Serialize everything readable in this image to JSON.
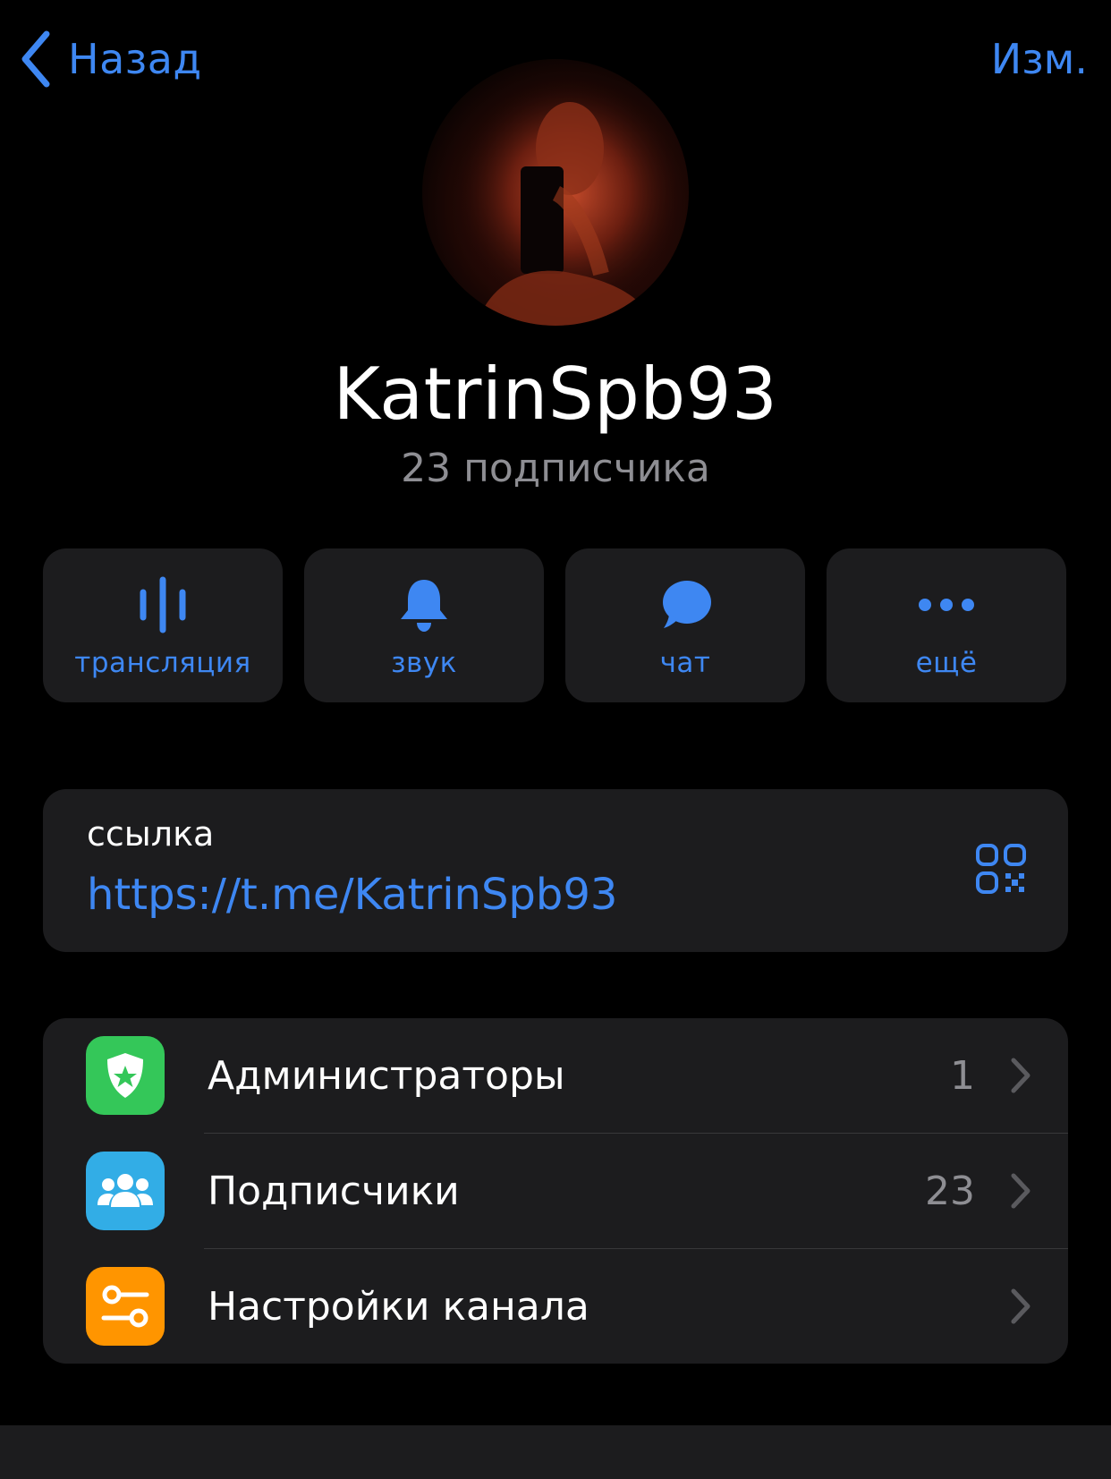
{
  "nav": {
    "back_label": "Назад",
    "edit_label": "Изм."
  },
  "channel": {
    "name": "KatrinSpb93",
    "subscribers_text": "23 подписчика"
  },
  "actions": [
    {
      "label": "трансляция",
      "icon": "broadcast-icon"
    },
    {
      "label": "звук",
      "icon": "bell-icon"
    },
    {
      "label": "чат",
      "icon": "chat-bubble-icon"
    },
    {
      "label": "ещё",
      "icon": "more-dots-icon"
    }
  ],
  "link": {
    "label": "ссылка",
    "url": "https://t.me/KatrinSpb93",
    "qr_icon": "qr-code-icon"
  },
  "list": [
    {
      "label": "Администраторы",
      "value": "1",
      "icon": "admin-badge-icon",
      "icon_color": "#34c759"
    },
    {
      "label": "Подписчики",
      "value": "23",
      "icon": "people-icon",
      "icon_color": "#32ade6"
    },
    {
      "label": "Настройки канала",
      "value": "",
      "icon": "sliders-icon",
      "icon_color": "#ff9500"
    }
  ],
  "colors": {
    "accent": "#3e87f2",
    "background": "#000000",
    "card": "#1c1c1e",
    "secondary_text": "#8e8e93"
  }
}
